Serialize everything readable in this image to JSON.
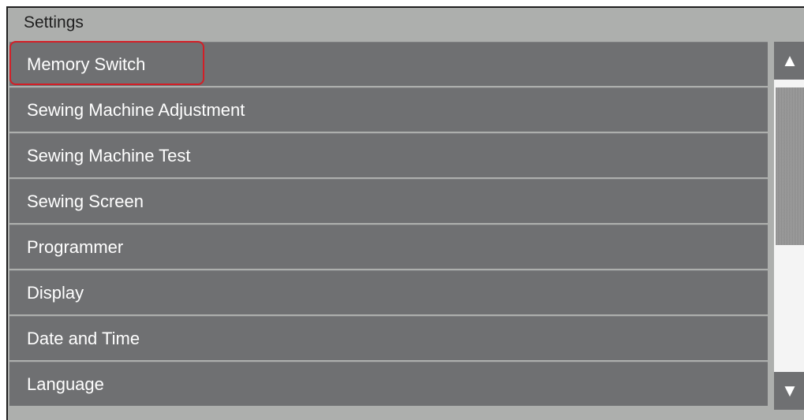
{
  "header": {
    "title": "Settings"
  },
  "menu": {
    "items": [
      {
        "label": "Memory Switch"
      },
      {
        "label": "Sewing Machine Adjustment"
      },
      {
        "label": "Sewing Machine Test"
      },
      {
        "label": "Sewing Screen"
      },
      {
        "label": "Programmer"
      },
      {
        "label": "Display"
      },
      {
        "label": "Date and Time"
      },
      {
        "label": "Language"
      }
    ],
    "selected_index": 0
  },
  "scrollbar": {
    "up_icon": "▲",
    "down_icon": "▼"
  },
  "colors": {
    "background": "#adafad",
    "item": "#6f7072",
    "highlight": "#d21f27",
    "text": "#ffffff"
  }
}
